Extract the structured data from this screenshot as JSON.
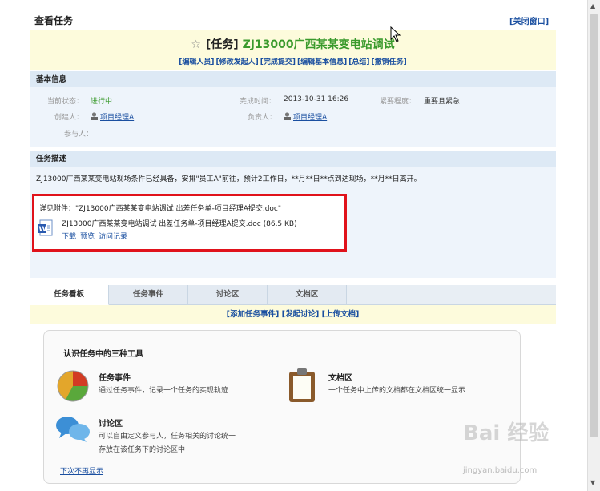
{
  "page": {
    "title": "查看任务",
    "close_link": "[关闭窗口]"
  },
  "task": {
    "star": "☆",
    "prefix": "[任务]",
    "name": "ZJ13000广西某某变电站调试",
    "actions": [
      "[编辑人员]",
      "[修改发起人]",
      "[完成提交]",
      "[编辑基本信息]",
      "[总结]",
      "[撤销任务]"
    ]
  },
  "basic_info": {
    "heading": "基本信息",
    "status_label": "当前状态：",
    "status_value": "进行中",
    "done_time_label": "完成时间：",
    "done_time_value": "2013-10-31 16:26",
    "urgency_label": "紧要程度：",
    "urgency_value": "重要且紧急",
    "creator_label": "创建人：",
    "creator_value": "项目经理A",
    "owner_label": "负责人：",
    "owner_value": "项目经理A",
    "participants_label": "参与人："
  },
  "description": {
    "heading": "任务描述",
    "text": "ZJ13000广西某某变电站现场条件已经具备，安排\"员工A\"前往，预计2工作日，**月**日**点到达现场，**月**日离开。",
    "attachment_intro": "详见附件：\"ZJ13000广西某某变电站调试 出差任务单-项目经理A提交.doc\"",
    "file_name": "ZJ13000广西某某变电站调试 出差任务单-项目经理A提交.doc (86.5 KB)",
    "file_links": [
      "下载",
      "预览",
      "访问记录"
    ]
  },
  "tabs": [
    "任务看板",
    "任务事件",
    "讨论区",
    "文档区"
  ],
  "tab_actions": "[添加任务事件] [发起讨论] [上传文档]",
  "tools": {
    "title": "认识任务中的三种工具",
    "event_title": "任务事件",
    "event_desc": "通过任务事件，记录一个任务的实现轨迹",
    "doc_title": "文档区",
    "doc_desc": "一个任务中上传的文档都在文档区统一显示",
    "discuss_title": "讨论区",
    "discuss_desc_1": "可以自由定义参与人，任务相关的讨论统一",
    "discuss_desc_2": "存放在该任务下的讨论区中",
    "dont_show": "下次不再显示"
  },
  "watermark": {
    "text": "Bai 经验",
    "url": "jingyan.baidu.com"
  },
  "colors": {
    "header_bg": "#fdfbdc",
    "section_bg": "#dde9f5",
    "link": "#1a4fa0",
    "task_name": "#3a9a2c",
    "highlight": "#e0121b"
  }
}
